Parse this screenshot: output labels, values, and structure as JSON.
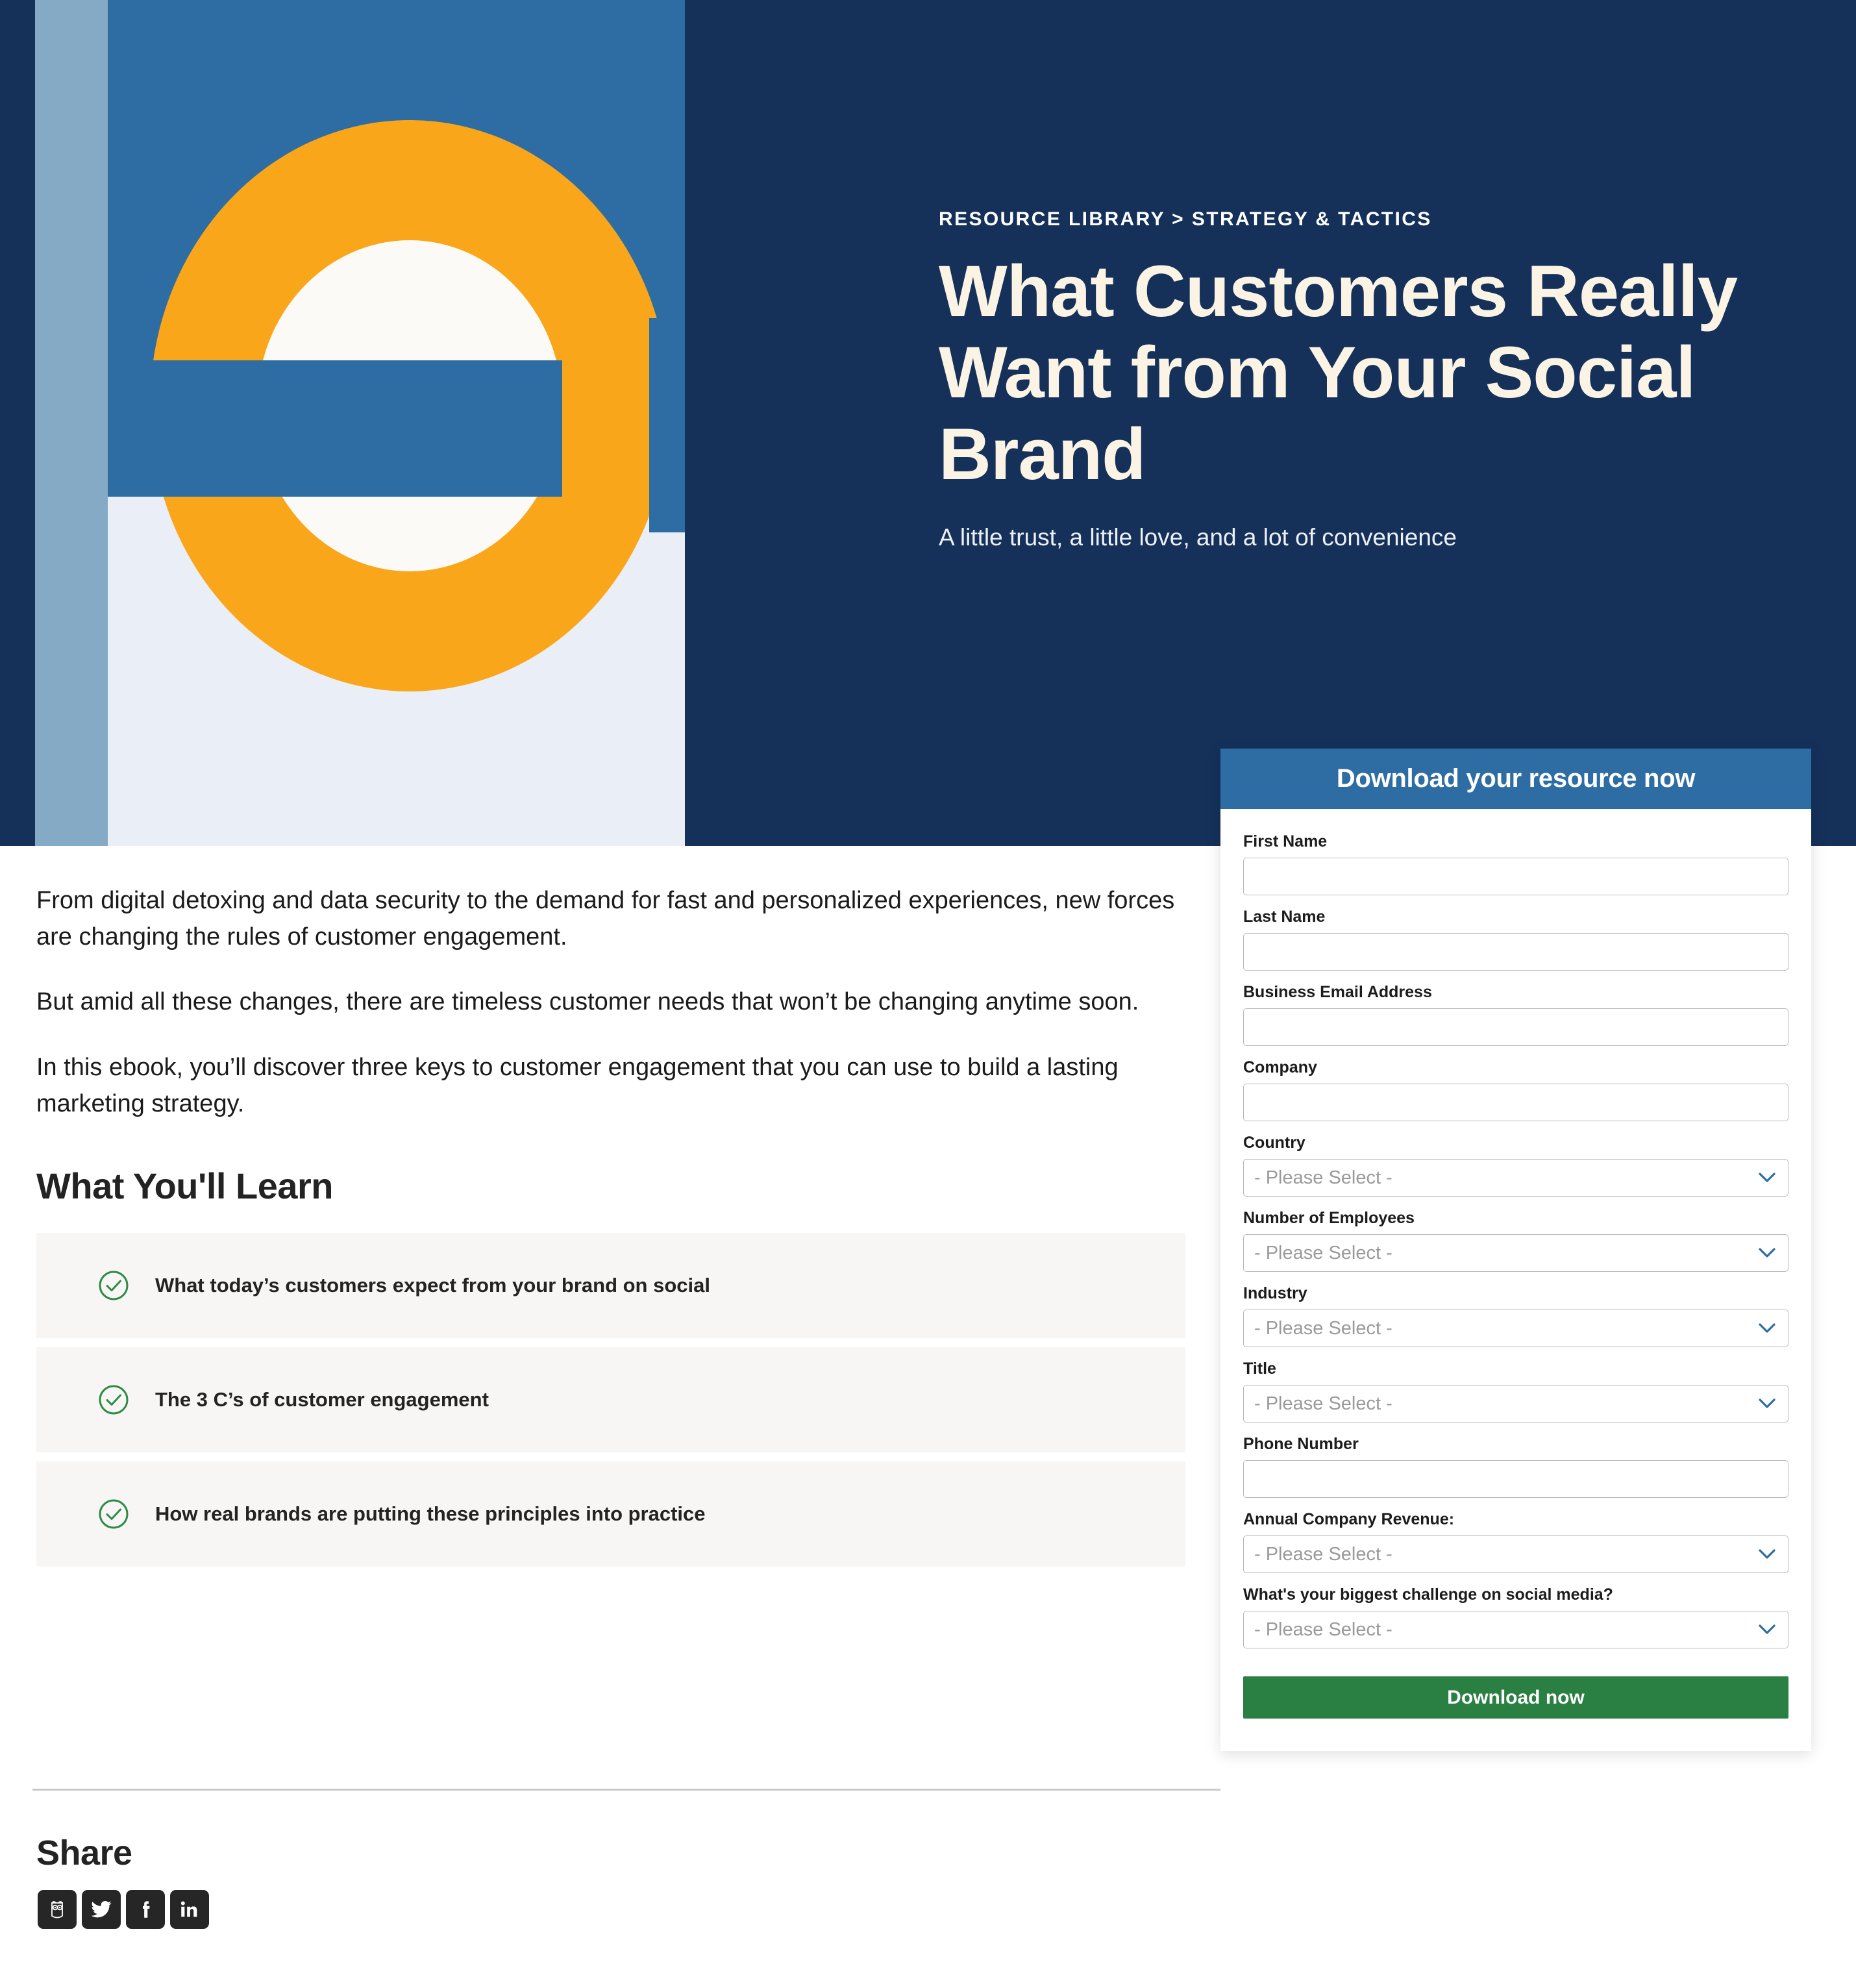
{
  "hero": {
    "breadcrumb": "RESOURCE LIBRARY > STRATEGY & TACTICS",
    "title": "What Customers Really Want from Your Social Brand",
    "subtitle": "A little trust, a little love, and a lot of convenience",
    "illustration_colors": {
      "navy": "#15315A",
      "blue": "#2E6DA4",
      "light_blue": "#85AAC6",
      "orange": "#FAA61A",
      "off_white": "#FBFAF7",
      "lavender": "#E9EEF7"
    }
  },
  "body": {
    "paragraphs": [
      "From digital detoxing and data security to the demand for fast and personalized experiences, new forces are changing the rules of customer engagement.",
      "But amid all these changes, there are timeless customer needs that won’t be changing anytime soon.",
      "In this ebook, you’ll discover three keys to customer engagement that you can use to build a lasting marketing strategy."
    ],
    "learn_heading": "What You'll Learn",
    "learn_items": [
      "What today’s customers expect from your brand on social",
      "The 3 C’s of customer engagement",
      "How real brands are putting these principles into practice"
    ],
    "check_color": "#2E8B45",
    "row_bg": "#F7F6F4"
  },
  "share": {
    "heading": "Share",
    "icons": [
      {
        "name": "hootsuite-owl-icon",
        "label": "Hootsuite"
      },
      {
        "name": "twitter-icon",
        "label": "Twitter"
      },
      {
        "name": "facebook-icon",
        "label": "Facebook"
      },
      {
        "name": "linkedin-icon",
        "label": "LinkedIn"
      }
    ]
  },
  "form": {
    "header_title": "Download your resource now",
    "header_bg": "#2E6DA4",
    "submit_label": "Download now",
    "submit_bg": "#2A8042",
    "placeholder_select": "- Please Select -",
    "fields": [
      {
        "label": "First Name",
        "type": "text",
        "value": ""
      },
      {
        "label": "Last Name",
        "type": "text",
        "value": ""
      },
      {
        "label": "Business Email Address",
        "type": "text",
        "value": ""
      },
      {
        "label": "Company",
        "type": "text",
        "value": ""
      },
      {
        "label": "Country",
        "type": "select",
        "value": "- Please Select -"
      },
      {
        "label": "Number of Employees",
        "type": "select",
        "value": "- Please Select -"
      },
      {
        "label": "Industry",
        "type": "select",
        "value": "- Please Select -"
      },
      {
        "label": "Title",
        "type": "select",
        "value": "- Please Select -"
      },
      {
        "label": "Phone Number",
        "type": "text",
        "value": ""
      },
      {
        "label": "Annual Company Revenue:",
        "type": "select",
        "value": "- Please Select -"
      },
      {
        "label": "What's your biggest challenge on social media?",
        "type": "select",
        "value": "- Please Select -"
      }
    ]
  }
}
